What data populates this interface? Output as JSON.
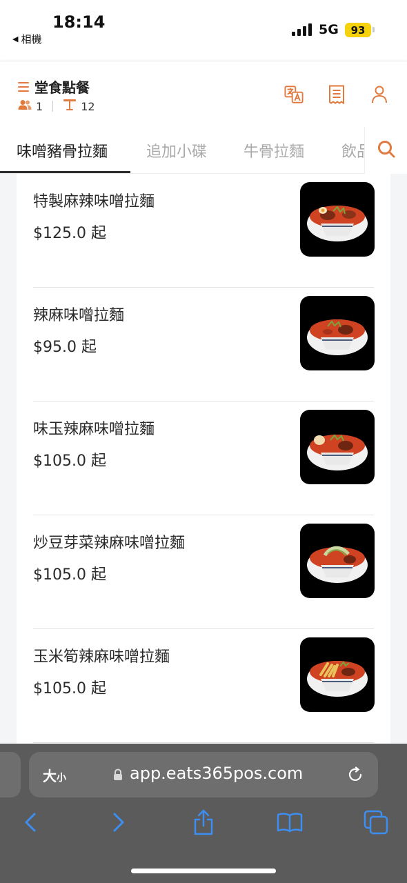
{
  "status_bar": {
    "time": "18:14",
    "back_label": "相機",
    "network": "5G",
    "battery": "93"
  },
  "header": {
    "title": "堂食點餐",
    "guests": "1",
    "table": "12",
    "icons": [
      "menu-icon",
      "translate-icon",
      "receipt-icon",
      "user-icon"
    ]
  },
  "tabs": [
    {
      "label": "味噌豬骨拉麵",
      "active": true
    },
    {
      "label": "追加小碟",
      "active": false
    },
    {
      "label": "牛骨拉麵",
      "active": false
    },
    {
      "label": "飲品",
      "active": false
    }
  ],
  "menu_items": [
    {
      "name": "特製麻辣味噌拉麵",
      "price": "$125.0 起"
    },
    {
      "name": "辣麻味噌拉麵",
      "price": "$95.0 起"
    },
    {
      "name": "味玉辣麻味噌拉麵",
      "price": "$105.0 起"
    },
    {
      "name": "炒豆芽菜辣麻味噌拉麵",
      "price": "$105.0 起"
    },
    {
      "name": "玉米筍辣麻味噌拉麵",
      "price": "$105.0 起"
    }
  ],
  "browser": {
    "text_size_big": "大",
    "text_size_small": "小",
    "url": "app.eats365pos.com"
  },
  "colors": {
    "accent": "#e07a3e",
    "ios_blue": "#3d8ef0",
    "battery": "#f5d20b"
  }
}
